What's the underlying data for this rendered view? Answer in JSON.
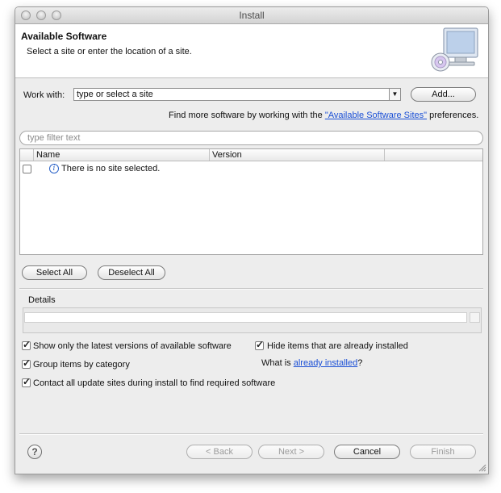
{
  "window": {
    "title": "Install"
  },
  "banner": {
    "title": "Available Software",
    "subtitle": "Select a site or enter the location of a site."
  },
  "work_with": {
    "label": "Work with:",
    "value": "type or select a site",
    "add_button": "Add...",
    "hint_prefix": "Find more software by working with the ",
    "hint_link": "\"Available Software Sites\"",
    "hint_suffix": " preferences."
  },
  "filter": {
    "placeholder": "type filter text"
  },
  "table": {
    "columns": [
      "Name",
      "Version"
    ],
    "empty_message": "There is no site selected."
  },
  "selection": {
    "select_all": "Select All",
    "deselect_all": "Deselect All"
  },
  "details": {
    "label": "Details"
  },
  "options": {
    "latest_versions": {
      "label": "Show only the latest versions of available software",
      "checked": true
    },
    "group_by_category": {
      "label": "Group items by category",
      "checked": true
    },
    "contact_sites": {
      "label": "Contact all update sites during install to find required software",
      "checked": true
    },
    "hide_installed": {
      "label": "Hide items that are already installed",
      "checked": true
    },
    "what_is_prefix": "What is ",
    "what_is_link": "already installed",
    "what_is_suffix": "?"
  },
  "footer": {
    "help": "?",
    "back": "< Back",
    "next": "Next >",
    "cancel": "Cancel",
    "finish": "Finish"
  }
}
